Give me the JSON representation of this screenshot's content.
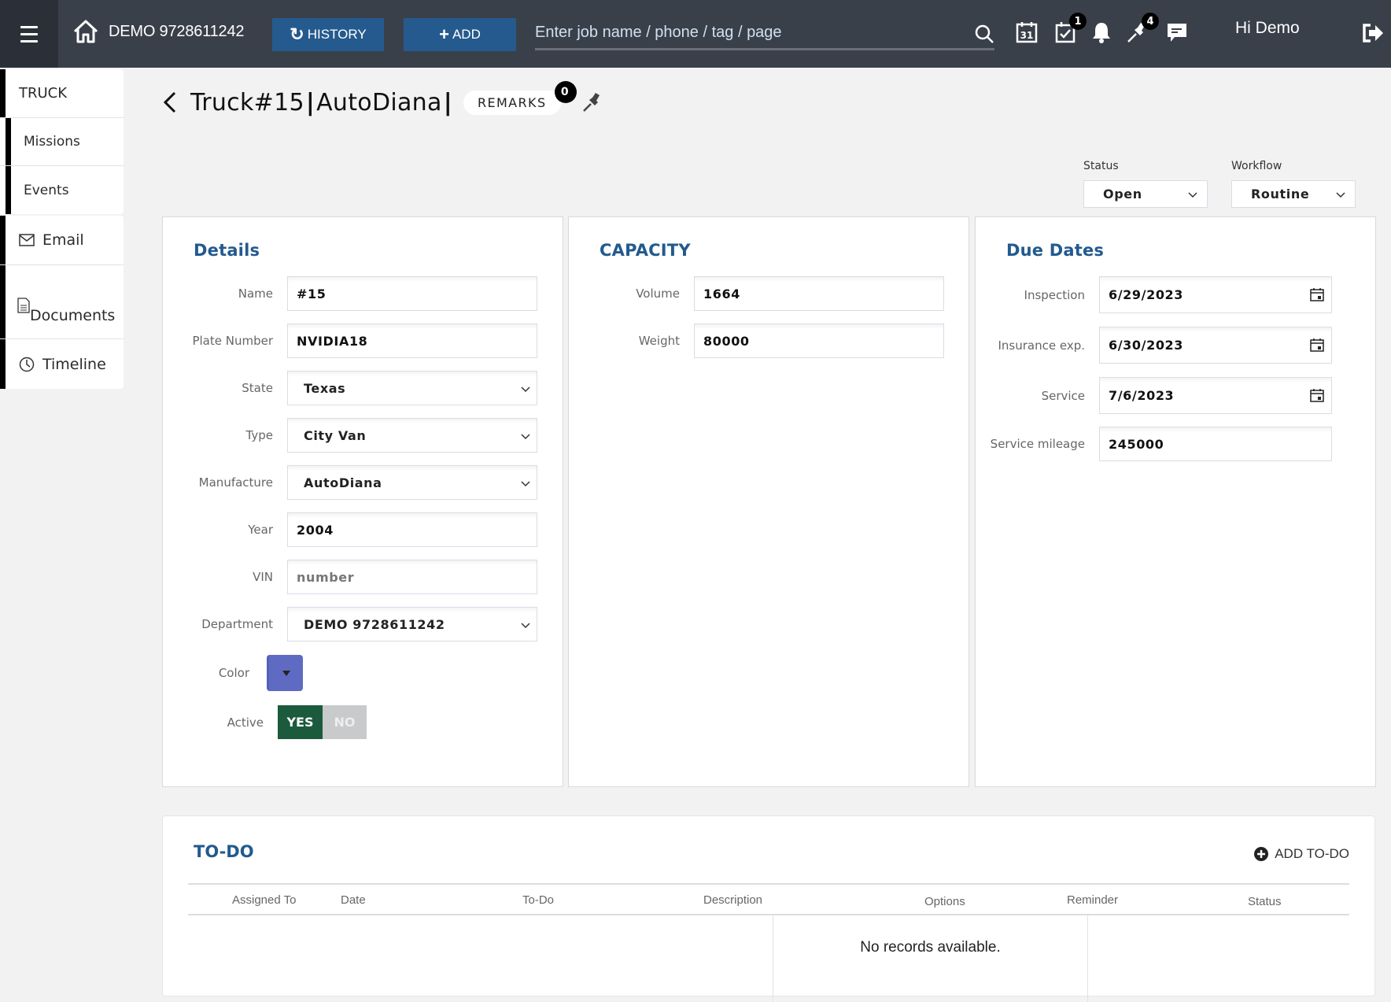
{
  "header": {
    "org_name": "DEMO 9728611242",
    "history_label": "HISTORY",
    "add_label": "ADD",
    "search_placeholder": "Enter job name / phone / tag / page",
    "tasks_badge": "1",
    "pins_badge": "4",
    "greeting": "Hi Demo"
  },
  "sidebar": {
    "truck": "TRUCK",
    "missions": "Missions",
    "events": "Events",
    "email": "Email",
    "documents": "Documents",
    "timeline": "Timeline"
  },
  "page": {
    "title_truck": "Truck#15",
    "title_sep": "|",
    "title_make": "AutoDiana",
    "remarks_label": "REMARKS",
    "remarks_count": "0"
  },
  "status": {
    "label": "Status",
    "value": "Open"
  },
  "workflow": {
    "label": "Workflow",
    "value": "Routine"
  },
  "details": {
    "title": "Details",
    "name": {
      "label": "Name",
      "value": "#15"
    },
    "plate": {
      "label": "Plate Number",
      "value": "NVIDIA18"
    },
    "state": {
      "label": "State",
      "value": "Texas"
    },
    "type": {
      "label": "Type",
      "value": "City Van"
    },
    "manufacture": {
      "label": "Manufacture",
      "value": "AutoDiana"
    },
    "year": {
      "label": "Year",
      "value": "2004"
    },
    "vin": {
      "label": "VIN",
      "value": "",
      "placeholder": "number"
    },
    "department": {
      "label": "Department",
      "value": "DEMO 9728611242"
    },
    "color": {
      "label": "Color",
      "value": "#5f6bc2"
    },
    "active": {
      "label": "Active",
      "yes": "YES",
      "no": "NO",
      "selected": "YES"
    }
  },
  "capacity": {
    "title": "CAPACITY",
    "volume": {
      "label": "Volume",
      "value": "1664"
    },
    "weight": {
      "label": "Weight",
      "value": "80000"
    }
  },
  "due_dates": {
    "title": "Due Dates",
    "inspection": {
      "label": "Inspection",
      "value": "6/29/2023"
    },
    "insurance": {
      "label": "Insurance exp.",
      "value": "6/30/2023"
    },
    "service": {
      "label": "Service",
      "value": "7/6/2023"
    },
    "mileage": {
      "label": "Service mileage",
      "value": "245000"
    }
  },
  "todo": {
    "title": "TO-DO",
    "add_label": "ADD TO-DO",
    "columns": [
      "Assigned To",
      "Date",
      "To-Do",
      "Description",
      "Options",
      "Reminder",
      "Status"
    ],
    "empty_text": "No records available."
  }
}
